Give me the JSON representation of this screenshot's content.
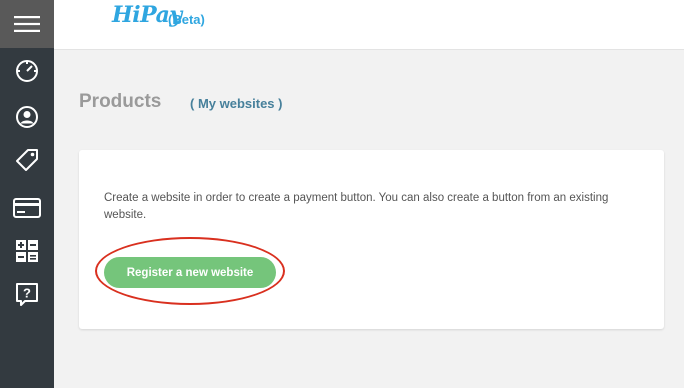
{
  "app": {
    "logo_text": "HiPay",
    "beta_label": "(Beta)",
    "brand_color": "#2fa6e0"
  },
  "sidebar": {
    "items": [
      {
        "icon": "menu-icon"
      },
      {
        "icon": "dashboard-icon"
      },
      {
        "icon": "user-icon"
      },
      {
        "icon": "tag-icon"
      },
      {
        "icon": "card-icon"
      },
      {
        "icon": "calculator-icon"
      },
      {
        "icon": "help-icon"
      }
    ]
  },
  "header": {
    "title": "Products",
    "link_label": "( My websites )"
  },
  "card": {
    "description": "Create a website in order to create a payment button. You can also create a button from an existing website.",
    "button_label": "Register a new website",
    "button_color": "#75c57b"
  },
  "annotation": {
    "highlight_color": "#d9301f"
  }
}
